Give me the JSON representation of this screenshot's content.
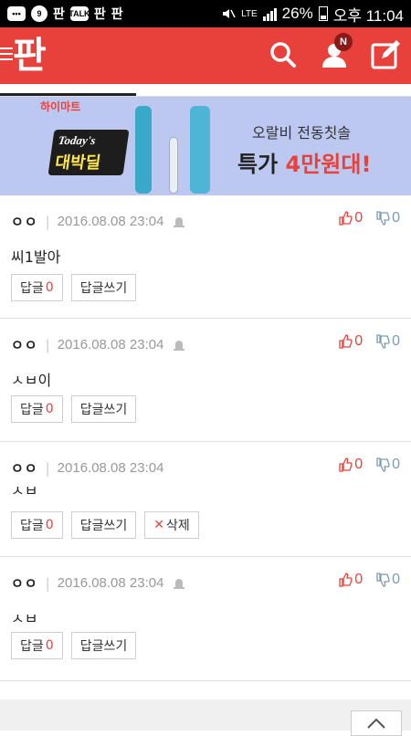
{
  "statusbar": {
    "icons_left": [
      "message-icon",
      "9",
      "판",
      "TALK",
      "판",
      "판"
    ],
    "lte": "LTE",
    "battery_percent": "26%",
    "time": "오후 11:04"
  },
  "appbar": {
    "logo": "판",
    "notification_badge": "N",
    "brand_color": "#e8413b"
  },
  "banner": {
    "store_logo": "하이마트",
    "badge_line1": "Today's",
    "badge_line2": "대박딜",
    "line1": "오랄비 전동칫솔",
    "line2_prefix": "특가 ",
    "line2_highlight": "4만원대!"
  },
  "comments": [
    {
      "author": "ㅇㅇ",
      "date": "2016.08.08 23:04",
      "text": "씨1발아",
      "up": "0",
      "down": "0",
      "reply_label": "답글",
      "reply_count": "0",
      "write_reply_label": "답글쓰기",
      "show_bell": true,
      "delete_label": null
    },
    {
      "author": "ㅇㅇ",
      "date": "2016.08.08 23:04",
      "text": "ㅅㅂ이",
      "up": "0",
      "down": "0",
      "reply_label": "답글",
      "reply_count": "0",
      "write_reply_label": "답글쓰기",
      "show_bell": true,
      "delete_label": null
    },
    {
      "author": "ㅇㅇ",
      "date": "2016.08.08 23:04",
      "text": "ㅅㅂ",
      "up": "0",
      "down": "0",
      "reply_label": "답글",
      "reply_count": "0",
      "write_reply_label": "답글쓰기",
      "show_bell": false,
      "delete_label": "삭제"
    },
    {
      "author": "ㅇㅇ",
      "date": "2016.08.08 23:04",
      "text": "ㅅㅂ",
      "up": "0",
      "down": "0",
      "reply_label": "답글",
      "reply_count": "0",
      "write_reply_label": "답글쓰기",
      "show_bell": true,
      "delete_label": null
    }
  ]
}
